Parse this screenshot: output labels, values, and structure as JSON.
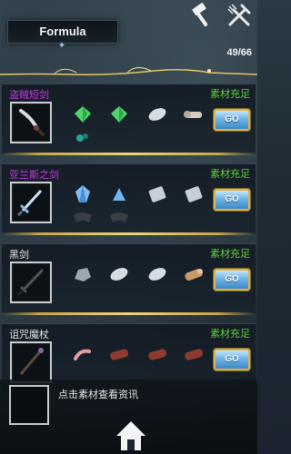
{
  "header": {
    "title": "Formula",
    "counter": "49/66"
  },
  "icons": {
    "top_left_tool": "hammer-icon",
    "top_right_tool": "fork-wrench-icon",
    "home": "home-icon"
  },
  "recipes": [
    {
      "name": "盗贼短剑",
      "name_color": "#c23ae0",
      "status": "素材充足",
      "go_label": "GO",
      "weapon": "dagger",
      "materials": [
        "green-crystal-icon",
        "green-crystal-icon",
        "silver-feather-icon",
        "bone-scroll-icon",
        "teal-flower-icon"
      ]
    },
    {
      "name": "亚兰斯之剑",
      "name_color": "#c23ae0",
      "status": "素材充足",
      "go_label": "GO",
      "weapon": "ornate-sword",
      "materials": [
        "blue-crystal-icon",
        "blue-shard-icon",
        "silver-scroll-icon",
        "silver-scroll-icon",
        "dark-cloth-icon",
        "dark-cloth-icon"
      ]
    },
    {
      "name": "黑剑",
      "name_color": "#dfe3e6",
      "status": "素材充足",
      "go_label": "GO",
      "weapon": "black-sword",
      "materials": [
        "gray-rock-icon",
        "silver-feather-icon",
        "silver-feather-icon",
        "wood-log-icon"
      ]
    },
    {
      "name": "诅咒魔杖",
      "name_color": "#dfe3e6",
      "status": "素材充足",
      "go_label": "GO",
      "weapon": "staff",
      "materials": [
        "pink-bone-icon",
        "red-log-icon",
        "red-log-icon",
        "red-log-icon"
      ]
    }
  ],
  "info": {
    "hint": "点击素材查看资讯"
  },
  "colors": {
    "status_green": "#5fcf3a",
    "gold": "#e7c466",
    "go_blue": "#6fb4e6"
  }
}
